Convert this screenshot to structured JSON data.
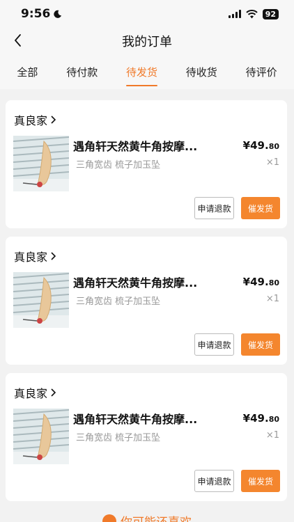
{
  "status_bar": {
    "time": "9:56",
    "battery": "92"
  },
  "nav": {
    "title": "我的订单"
  },
  "tabs": [
    "全部",
    "待付款",
    "待发货",
    "待收货",
    "待评价"
  ],
  "active_tab": "待发货",
  "orders": [
    {
      "shop": "真良家",
      "title": "遇角轩天然黄牛角按摩...",
      "spec": "三角宽齿  梳子加玉坠",
      "price_main": "¥49.",
      "price_cents": "80",
      "qty": "×1",
      "refund": "申请退款",
      "urge": "催发货"
    },
    {
      "shop": "真良家",
      "title": "遇角轩天然黄牛角按摩...",
      "spec": "三角宽齿  梳子加玉坠",
      "price_main": "¥49.",
      "price_cents": "80",
      "qty": "×1",
      "refund": "申请退款",
      "urge": "催发货"
    },
    {
      "shop": "真良家",
      "title": "遇角轩天然黄牛角按摩...",
      "spec": "三角宽齿  梳子加玉坠",
      "price_main": "¥49.",
      "price_cents": "80",
      "qty": "×1",
      "refund": "申请退款",
      "urge": "催发货"
    }
  ],
  "footer": {
    "text": "你可能还喜欢"
  },
  "colors": {
    "accent": "#f07a2a",
    "button": "#f4862e",
    "background": "#f2f2f2"
  }
}
